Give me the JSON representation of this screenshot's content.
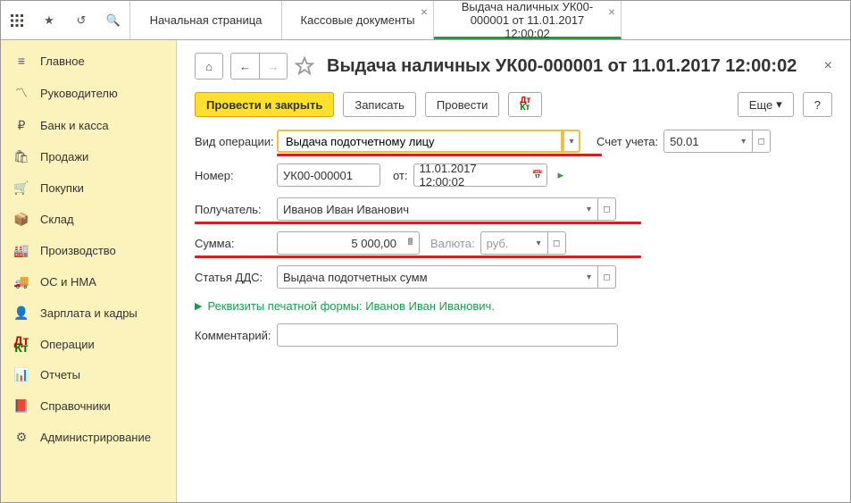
{
  "topbar": {
    "tabs": [
      {
        "label": "Начальная страница",
        "closable": false
      },
      {
        "label": "Кассовые документы",
        "closable": true
      },
      {
        "label": "Выдача наличных УК00-000001 от 11.01.2017 12:00:02",
        "closable": true,
        "active": true
      }
    ]
  },
  "sidebar": {
    "items": [
      {
        "label": "Главное",
        "icon": "≡"
      },
      {
        "label": "Руководителю",
        "icon": "📈"
      },
      {
        "label": "Банк и касса",
        "icon": "₽"
      },
      {
        "label": "Продажи",
        "icon": "🛍"
      },
      {
        "label": "Покупки",
        "icon": "🛒"
      },
      {
        "label": "Склад",
        "icon": "📦"
      },
      {
        "label": "Производство",
        "icon": "🏭"
      },
      {
        "label": "ОС и НМА",
        "icon": "🚚"
      },
      {
        "label": "Зарплата и кадры",
        "icon": "👤"
      },
      {
        "label": "Операции",
        "icon": "ДтКт"
      },
      {
        "label": "Отчеты",
        "icon": "📊"
      },
      {
        "label": "Справочники",
        "icon": "📕"
      },
      {
        "label": "Администрирование",
        "icon": "⚙"
      }
    ]
  },
  "header": {
    "title": "Выдача наличных УК00-000001 от 11.01.2017 12:00:02"
  },
  "actions": {
    "post_close": "Провести и закрыть",
    "write": "Записать",
    "post": "Провести",
    "more": "Еще",
    "help": "?"
  },
  "form": {
    "operation_label": "Вид операции:",
    "operation_value": "Выдача подотчетному лицу",
    "account_label": "Счет учета:",
    "account_value": "50.01",
    "number_label": "Номер:",
    "number_value": "УК00-000001",
    "from_label": "от:",
    "date_value": "11.01.2017 12:00:02",
    "recipient_label": "Получатель:",
    "recipient_value": "Иванов Иван Иванович",
    "amount_label": "Сумма:",
    "amount_value": "5 000,00",
    "currency_label": "Валюта:",
    "currency_value": "руб.",
    "dds_label": "Статья ДДС:",
    "dds_value": "Выдача подотчетных сумм",
    "print_details": "Реквизиты печатной формы: Иванов Иван Иванович.",
    "comment_label": "Комментарий:",
    "comment_value": ""
  }
}
